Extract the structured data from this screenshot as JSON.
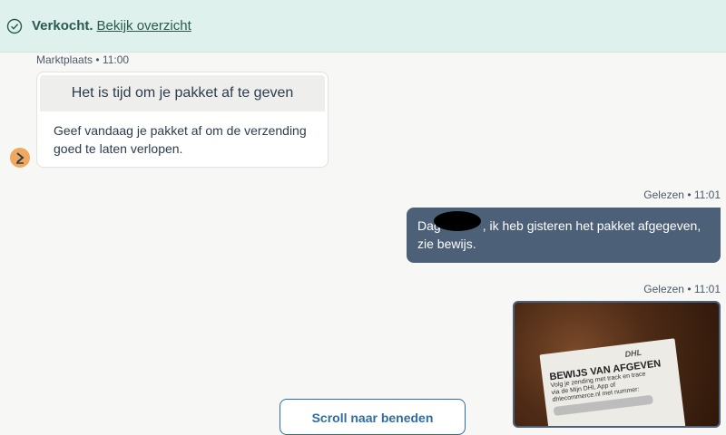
{
  "banner": {
    "status_text": "Verkocht.",
    "link_text": "Bekijk overzicht",
    "icon": "check-circle-icon",
    "accent_color": "#2a5a4f"
  },
  "system_message": {
    "sender": "Marktplaats",
    "separator": "•",
    "time": "11:00",
    "title": "Het is tijd om je pakket af te geven",
    "body": "Geef vandaag je pakket af om de verzending goed te laten verlopen.",
    "avatar_icon": "chevron-right-icon"
  },
  "user_message": {
    "status": "Gelezen",
    "separator": "•",
    "time": "11:01",
    "text_before_redaction": "Dag",
    "text_after_redaction": ", ik heb gisteren het pakket afgegeven, zie bewijs.",
    "bubble_color": "#4c6077"
  },
  "image_message": {
    "status": "Gelezen",
    "separator": "•",
    "time": "11:01",
    "receipt": {
      "brand": "DHL",
      "title": "BEWIJS VAN AFGEVEN",
      "line1": "Volg je zending met track en trace",
      "line2": "via de Mijn DHL App of",
      "line3": "dhlecommerce.nl met nummer:"
    }
  },
  "scroll_button": {
    "label": "Scroll naar beneden"
  }
}
